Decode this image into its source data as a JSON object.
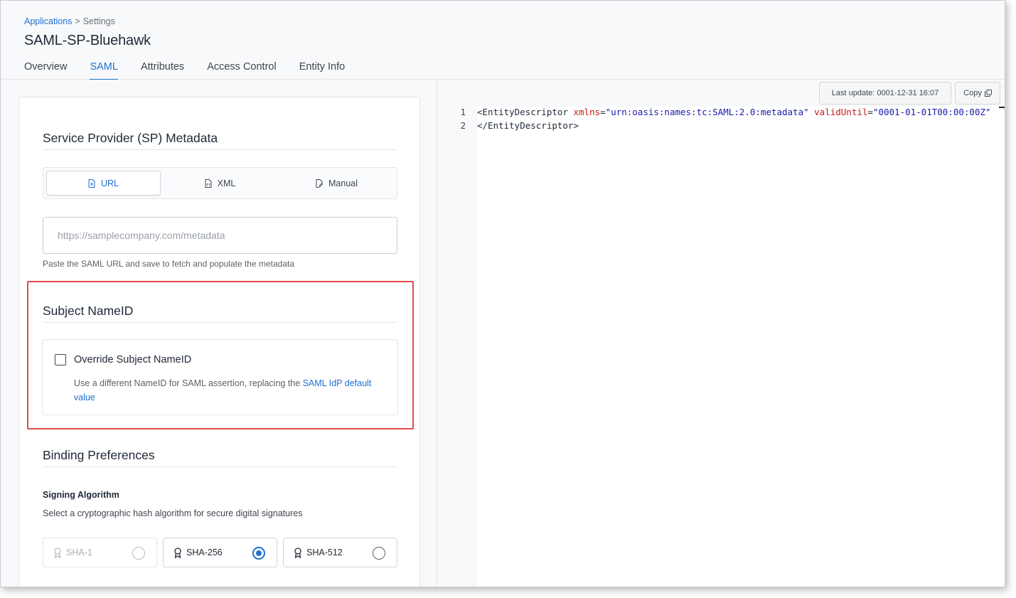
{
  "breadcrumb": {
    "parent": "Applications",
    "separator": ">",
    "current": "Settings"
  },
  "app_title": "SAML-SP-Bluehawk",
  "tabs": [
    {
      "label": "Overview",
      "active": false
    },
    {
      "label": "SAML",
      "active": true
    },
    {
      "label": "Attributes",
      "active": false
    },
    {
      "label": "Access Control",
      "active": false
    },
    {
      "label": "Entity Info",
      "active": false
    }
  ],
  "sp_metadata": {
    "title": "Service Provider (SP) Metadata",
    "modes": [
      {
        "label": "URL",
        "icon": "file-icon",
        "active": true
      },
      {
        "label": "XML",
        "icon": "file-code-icon",
        "active": false
      },
      {
        "label": "Manual",
        "icon": "file-edit-icon",
        "active": false
      }
    ],
    "url_placeholder": "https://samplecompany.com/metadata",
    "url_value": "",
    "help_text": "Paste the SAML URL and save to fetch and populate the metadata"
  },
  "subject_nameid": {
    "title": "Subject NameID",
    "checkbox_label": "Override Subject NameID",
    "checked": false,
    "description": "Use a different NameID for SAML assertion, replacing the ",
    "link_text": "SAML IdP default value"
  },
  "binding": {
    "title": "Binding Preferences",
    "signing_title": "Signing Algorithm",
    "signing_desc": "Select a cryptographic hash algorithm for secure digital signatures",
    "options": [
      {
        "label": "SHA-1",
        "disabled": true,
        "selected": false
      },
      {
        "label": "SHA-256",
        "disabled": false,
        "selected": true
      },
      {
        "label": "SHA-512",
        "disabled": false,
        "selected": false
      }
    ]
  },
  "editor": {
    "last_update": "Last update: 0001-12-31 16:07",
    "copy_label": "Copy",
    "line_numbers": [
      "1",
      "2"
    ],
    "line1": {
      "open": "<EntityDescriptor",
      "attr1": "xmlns",
      "eq1": "=",
      "val1": "\"urn:oasis:names:tc:SAML:2.0:metadata\"",
      "attr2": "validUntil",
      "eq2": "=",
      "val2": "\"0001-01-01T00:00:00Z\""
    },
    "line2": "</EntityDescriptor>"
  },
  "colors": {
    "accent": "#1f6fd1",
    "highlight": "#e24b4b",
    "xml_attr": "#c41a16",
    "xml_value": "#1a1aa6"
  }
}
